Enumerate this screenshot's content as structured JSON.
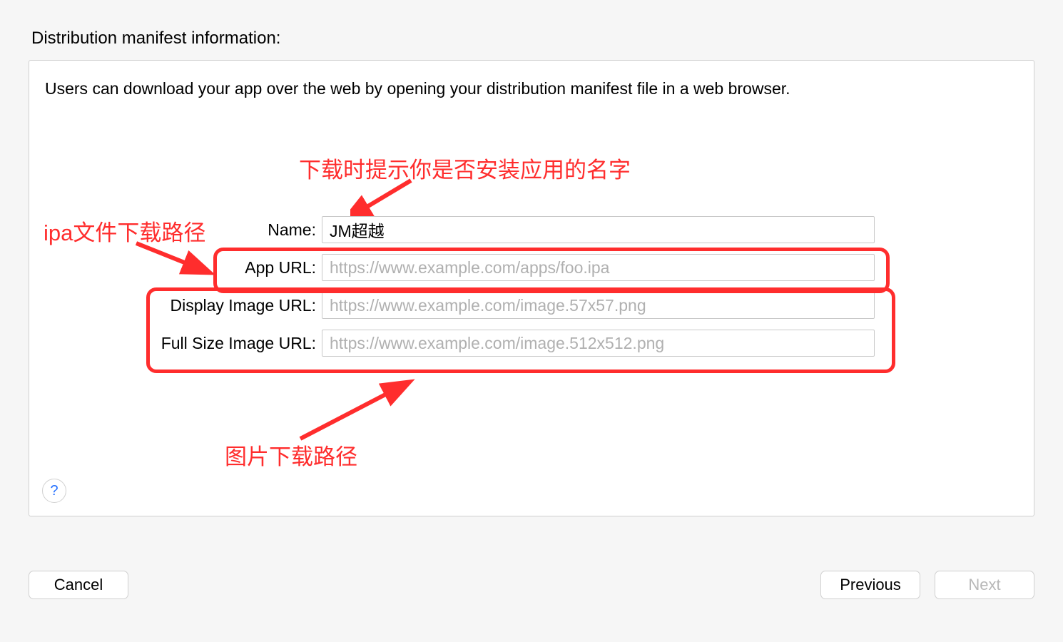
{
  "title": "Distribution manifest information:",
  "description": "Users can download your app over the web by opening your distribution manifest file in a web browser.",
  "form": {
    "name_label": "Name:",
    "name_value": "JM超越",
    "app_url_label": "App URL:",
    "app_url_placeholder": "https://www.example.com/apps/foo.ipa",
    "display_image_label": "Display Image URL:",
    "display_image_placeholder": "https://www.example.com/image.57x57.png",
    "full_image_label": "Full Size Image URL:",
    "full_image_placeholder": "https://www.example.com/image.512x512.png"
  },
  "annotations": {
    "name_hint": "下载时提示你是否安装应用的名字",
    "ipa_hint": "ipa文件下载路径",
    "image_hint": "图片下载路径"
  },
  "help_glyph": "?",
  "buttons": {
    "cancel": "Cancel",
    "previous": "Previous",
    "next": "Next"
  }
}
